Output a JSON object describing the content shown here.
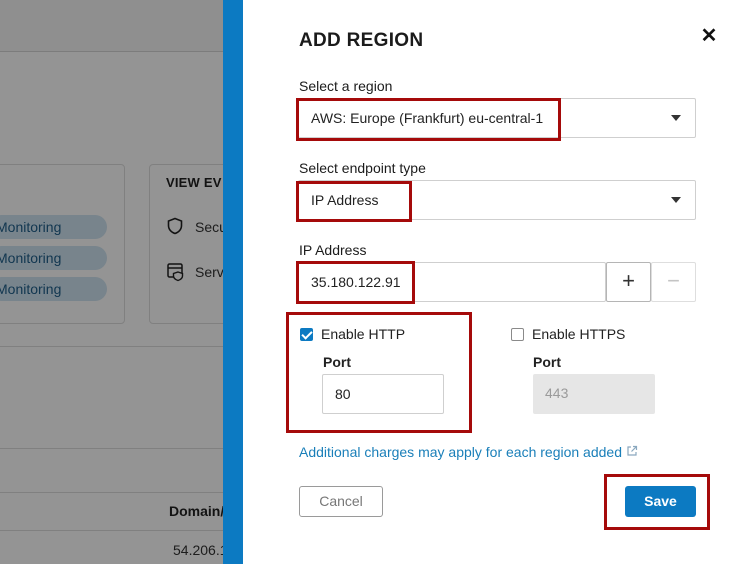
{
  "background": {
    "monitoring_pills": [
      "Monitoring",
      "Monitoring",
      "Monitoring"
    ],
    "card_title": "VIEW EV",
    "rows": [
      {
        "icon": "shield-icon",
        "text": "Secu"
      },
      {
        "icon": "server-icon",
        "text": "Serv"
      }
    ],
    "column_header": "Domain/",
    "cell_value": "54.206.1"
  },
  "panel": {
    "title": "ADD REGION",
    "close_glyph": "✕",
    "region": {
      "label": "Select a region",
      "value": "AWS: Europe (Frankfurt) eu-central-1"
    },
    "endpoint": {
      "label": "Select endpoint type",
      "value": "IP Address"
    },
    "ip": {
      "label": "IP Address",
      "value": "35.180.122.91",
      "add_glyph": "+",
      "remove_glyph": "−"
    },
    "http": {
      "label": "Enable HTTP",
      "checked": true,
      "port_label": "Port",
      "port_value": "80"
    },
    "https": {
      "label": "Enable HTTPS",
      "checked": false,
      "port_label": "Port",
      "port_placeholder": "443"
    },
    "charges_text": "Additional charges may apply for each region added",
    "cancel_label": "Cancel",
    "save_label": "Save"
  },
  "colors": {
    "accent": "#0c7ac2",
    "highlight": "#a50a0a",
    "link": "#1a7fb9"
  }
}
